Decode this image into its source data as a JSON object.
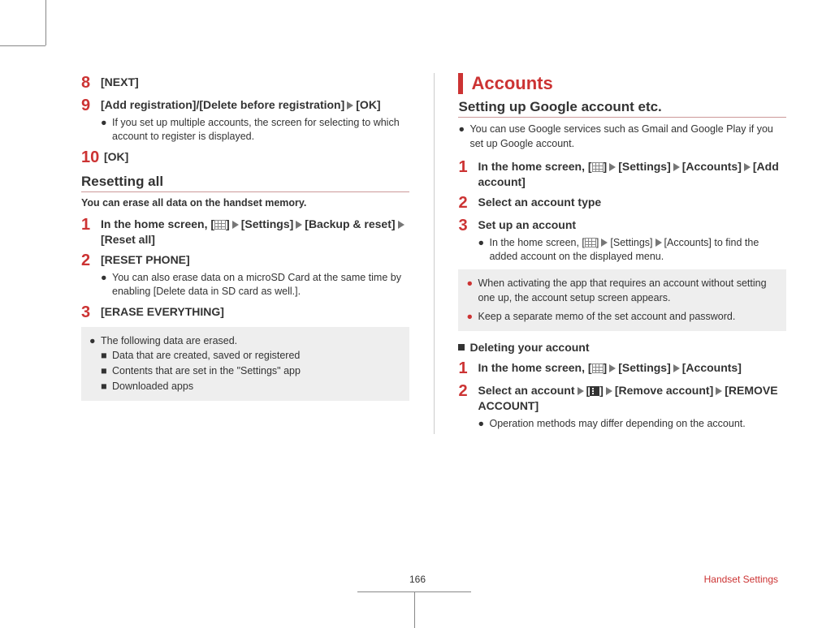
{
  "pageNumber": "166",
  "footerText": "Handset Settings",
  "left": {
    "steps": {
      "s8": "[NEXT]",
      "s9": "[Add registration]/[Delete before registration]",
      "s9_tail": "[OK]",
      "s9_note": "If you set up multiple accounts, the screen for selecting to which account to register is displayed.",
      "s10": "[OK]"
    },
    "h2": "Resetting all",
    "intro": "You can erase all data on the handset memory.",
    "r1_a": "In the home screen, [",
    "r1_b": "[Settings]",
    "r1_c": "[Backup & reset]",
    "r1_d": "[Reset all]",
    "r2": "[RESET PHONE]",
    "r2_note": "You can also erase data on a microSD Card at the same time by enabling [Delete data in SD card as well.].",
    "r3": "[ERASE EVERYTHING]",
    "box": {
      "lead": "The following data are erased.",
      "b1": "Data that are created, saved or registered",
      "b2": "Contents that are set in the \"Settings\" app",
      "b3": "Downloaded apps"
    }
  },
  "right": {
    "title": "Accounts",
    "h2": "Setting up Google account etc.",
    "intro": "You can use Google services such as Gmail and Google Play if you set up Google account.",
    "a1_a": "In the home screen, [",
    "a1_b": "[Settings]",
    "a1_c": "[Accounts]",
    "a1_d": "[Add account]",
    "a2": "Select an account type",
    "a3": "Set up an account",
    "a3_note_a": "In the home screen, [",
    "a3_note_b": "[Settings]",
    "a3_note_c": "[Accounts] to find the added account on the displayed menu.",
    "box1": "When activating the app that requires an account without setting one up, the account setup screen appears.",
    "box2": "Keep a separate memo of the set account and password.",
    "subhead": "Deleting your account",
    "d1_a": "In the home screen, [",
    "d1_b": "[Settings]",
    "d1_c": "[Accounts]",
    "d2_a": "Select an account",
    "d2_b": "[",
    "d2_c": "]",
    "d2_d": "[Remove account]",
    "d2_e": "[REMOVE ACCOUNT]",
    "d2_note": "Operation methods may differ depending on the account."
  }
}
